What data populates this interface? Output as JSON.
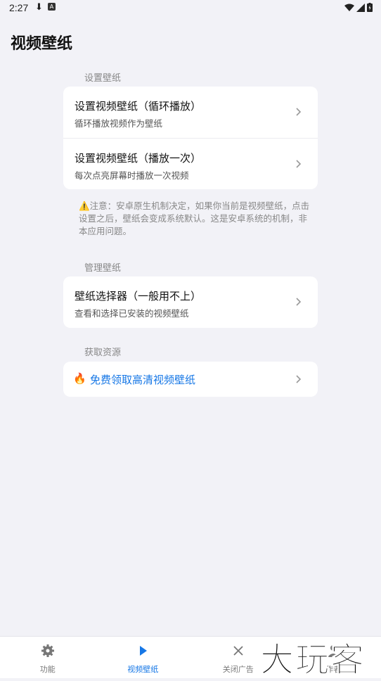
{
  "status_bar": {
    "time": "2:27"
  },
  "header": {
    "title": "视频壁纸"
  },
  "sections": {
    "set_label": "设置壁纸",
    "manage_label": "管理壁纸",
    "resource_label": "获取资源"
  },
  "set_items": [
    {
      "title": "设置视频壁纸（循环播放）",
      "subtitle": "循环播放视频作为壁纸"
    },
    {
      "title": "设置视频壁纸（播放一次）",
      "subtitle": "每次点亮屏幕时播放一次视频"
    }
  ],
  "note": "⚠️注意：安卓原生机制决定，如果你当前是视频壁纸，点击设置之后，壁纸会变成系统默认。这是安卓系统的机制，非本应用问题。",
  "manage_items": [
    {
      "title": "壁纸选择器（一般用不上）",
      "subtitle": "查看和选择已安装的视频壁纸"
    }
  ],
  "resource_item": {
    "title": "免费领取高清视频壁纸",
    "icon": "fire-icon"
  },
  "bottom_nav": [
    {
      "label": "功能",
      "icon": "gear-icon"
    },
    {
      "label": "视频壁纸",
      "icon": "play-icon",
      "active": true
    },
    {
      "label": "关闭广告",
      "icon": "close-icon"
    },
    {
      "label": "作者",
      "icon": "person-icon"
    }
  ],
  "watermark": "大玩客",
  "colors": {
    "accent": "#1677e6",
    "background": "#f2f2f7",
    "card": "#ffffff"
  }
}
